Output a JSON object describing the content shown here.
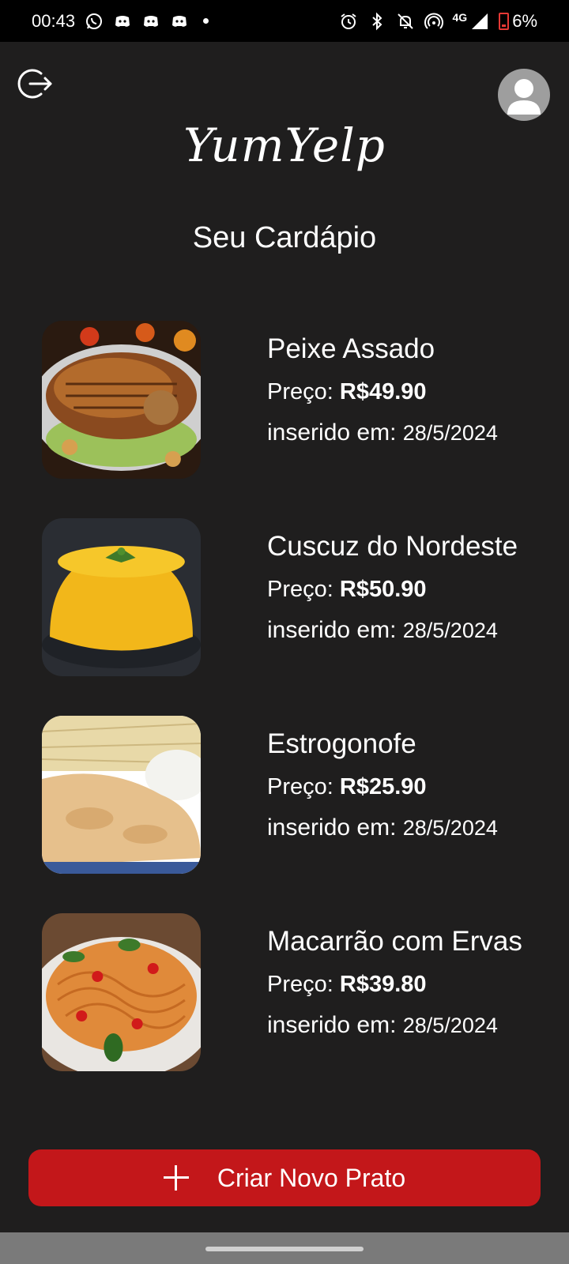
{
  "status_bar": {
    "time": "00:43",
    "network": "4G",
    "battery": "6%",
    "icons": [
      "whatsapp-icon",
      "discord-icon",
      "discord-icon",
      "discord-icon",
      "alarm-icon",
      "bluetooth-icon",
      "mute-icon",
      "hotspot-icon",
      "signal-icon",
      "battery-low-icon"
    ]
  },
  "header": {
    "logo": "YumYelp",
    "title": "Seu Cardápio"
  },
  "dishes": [
    {
      "name": "Peixe Assado",
      "price_label": "Preço:",
      "price": "R$49.90",
      "date_label": "inserido em:",
      "date": "28/5/2024"
    },
    {
      "name": "Cuscuz do Nordeste",
      "price_label": "Preço:",
      "price": "R$50.90",
      "date_label": "inserido em:",
      "date": "28/5/2024"
    },
    {
      "name": "Estrogonofe",
      "price_label": "Preço:",
      "price": "R$25.90",
      "date_label": "inserido em:",
      "date": "28/5/2024"
    },
    {
      "name": "Macarrão com Ervas",
      "price_label": "Preço:",
      "price": "R$39.80",
      "date_label": "inserido em:",
      "date": "28/5/2024"
    }
  ],
  "create_button": {
    "label": "Criar Novo Prato"
  },
  "colors": {
    "background": "#1f1e1e",
    "accent": "#c3171a",
    "text": "#ffffff"
  }
}
